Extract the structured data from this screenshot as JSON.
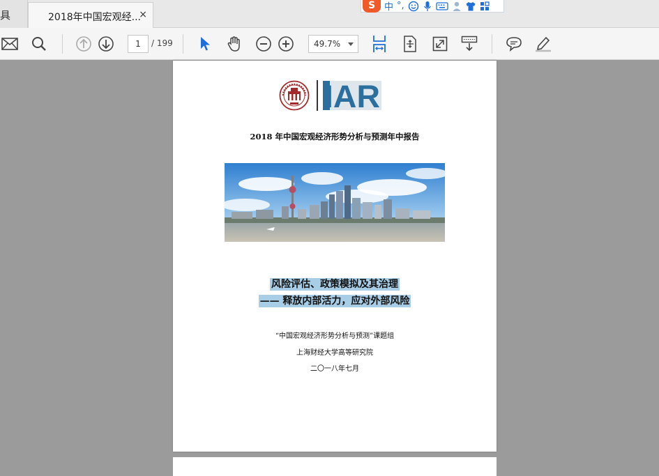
{
  "window": {
    "left_tab_label": "具",
    "active_tab_title": "2018年中国宏观经...",
    "close_glyph": "×"
  },
  "ime": {
    "logo": "S",
    "mode": "中",
    "punct": "°,"
  },
  "toolbar": {
    "page_current": "1",
    "page_total": "/ 199",
    "zoom": "49.7%"
  },
  "document": {
    "report_title": "2018 年中国宏观经济形势分析与预测年中报告",
    "title_line1": "风险评估、政策模拟及其治理",
    "title_line2": "—— 释放内部活力，应对外部风险",
    "group": "“中国宏观经济形势分析与预测”课题组",
    "institute": "上海财经大学高等研究院",
    "date": "二〇一八年七月",
    "logo_text": "IAR"
  },
  "colors": {
    "accent_blue": "#1e6fd9",
    "highlight": "#a8cde6",
    "iar_blue": "#2b6f9e"
  }
}
